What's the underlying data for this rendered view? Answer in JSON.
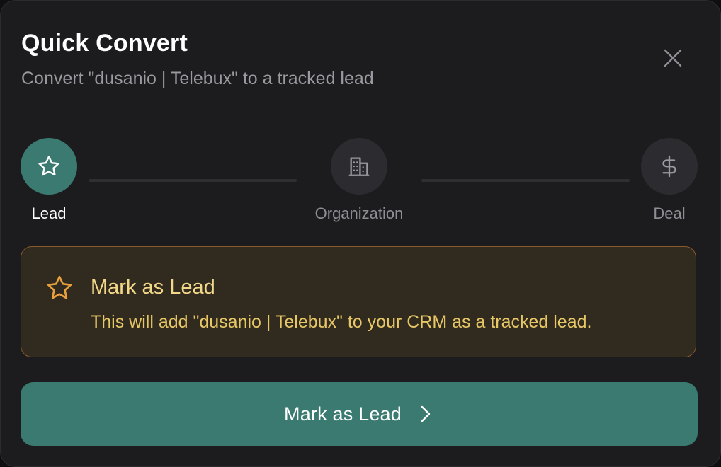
{
  "dialog": {
    "title": "Quick Convert",
    "subtitle": "Convert \"dusanio | Telebux\" to a tracked lead",
    "close_icon": "close-icon"
  },
  "steps": [
    {
      "label": "Lead",
      "icon": "star-icon",
      "state": "active"
    },
    {
      "label": "Organization",
      "icon": "building-icon",
      "state": "inactive"
    },
    {
      "label": "Deal",
      "icon": "dollar-icon",
      "state": "inactive"
    }
  ],
  "info": {
    "icon": "star-icon",
    "title": "Mark as Lead",
    "description": "This will add \"dusanio | Telebux\" to your CRM as a tracked lead."
  },
  "primary_button": {
    "label": "Mark as Lead",
    "icon": "chevron-right-icon"
  },
  "colors": {
    "background": "#1c1c1f",
    "accent": "#3a7a70",
    "warning_bg": "#312a1f",
    "warning_border": "#8a5a2c",
    "warning_text": "#e7c766"
  }
}
